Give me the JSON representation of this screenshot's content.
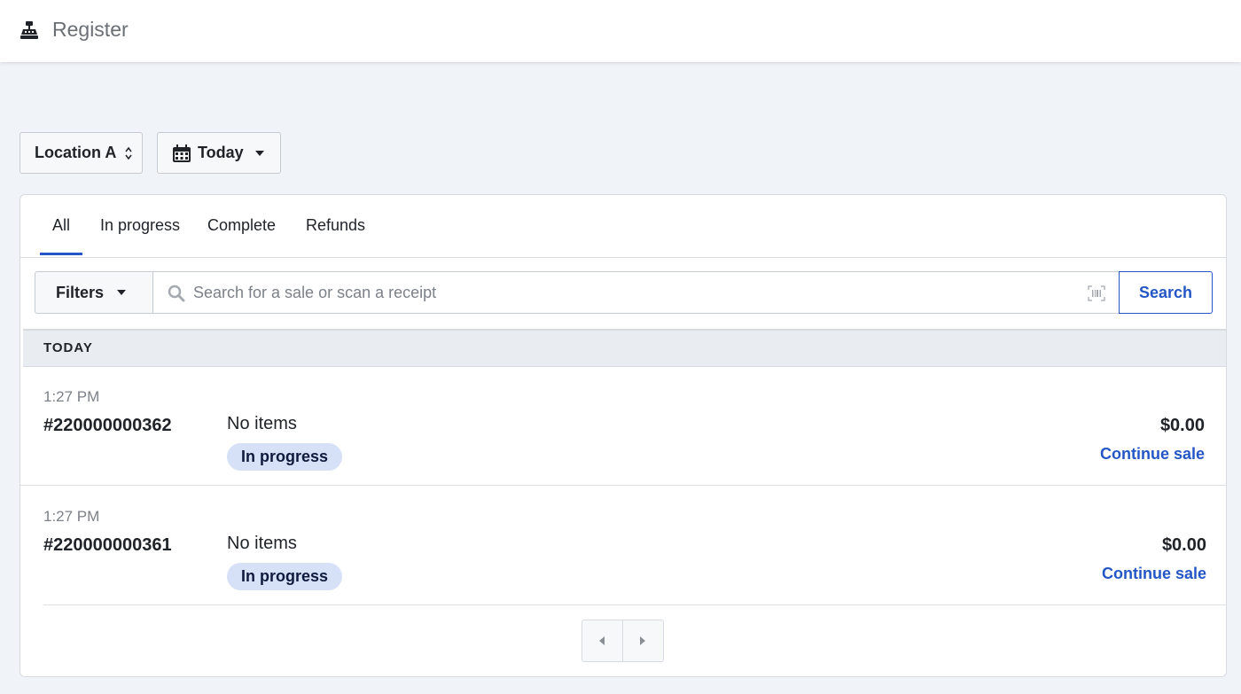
{
  "app": {
    "title": "Register",
    "icon": "register-icon"
  },
  "controls": {
    "location": {
      "label": "Location A",
      "icon": "up-down-chevron-icon"
    },
    "date": {
      "label": "Today",
      "icon": "calendar-icon"
    }
  },
  "tabs": [
    {
      "label": "All",
      "active": true
    },
    {
      "label": "In progress",
      "active": false
    },
    {
      "label": "Complete",
      "active": false
    },
    {
      "label": "Refunds",
      "active": false
    }
  ],
  "search": {
    "filters_label": "Filters",
    "placeholder": "Search for a sale or scan a receipt",
    "value": "",
    "button_label": "Search"
  },
  "group": {
    "label": "TODAY"
  },
  "sales": [
    {
      "time": "1:27 PM",
      "number": "#220000000362",
      "items": "No items",
      "status": "In progress",
      "amount": "$0.00",
      "action": "Continue sale"
    },
    {
      "time": "1:27 PM",
      "number": "#220000000361",
      "items": "No items",
      "status": "In progress",
      "amount": "$0.00",
      "action": "Continue sale"
    }
  ],
  "colors": {
    "accent": "#2457c5",
    "background": "#f0f3f7",
    "badge_bg": "#d6e0f7"
  }
}
